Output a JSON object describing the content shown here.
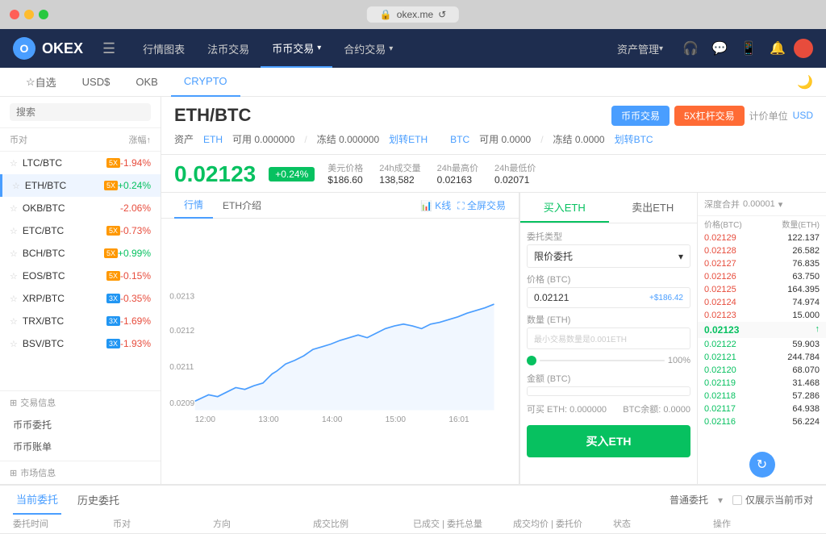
{
  "window": {
    "url": "okex.me",
    "lock_icon": "🔒"
  },
  "navbar": {
    "logo": "OKEX",
    "hamburger": "☰",
    "items": [
      {
        "label": "行情图表",
        "active": false
      },
      {
        "label": "法币交易",
        "active": false
      },
      {
        "label": "币币交易",
        "active": true,
        "dropdown": true
      },
      {
        "label": "合约交易",
        "active": false,
        "dropdown": true
      }
    ],
    "right_items": [
      {
        "label": "资产管理",
        "dropdown": true
      },
      {
        "label": "🎧"
      },
      {
        "label": "💬"
      },
      {
        "label": "📱"
      },
      {
        "label": "🔔"
      }
    ]
  },
  "subnav": {
    "items": [
      {
        "label": "☆ 自选",
        "active": false
      },
      {
        "label": "USD$",
        "active": false
      },
      {
        "label": "OKB",
        "active": false
      },
      {
        "label": "CRYPTO",
        "active": true
      }
    ]
  },
  "sidebar": {
    "search_placeholder": "搜索",
    "col1": "币对",
    "col2": "涨幅↑",
    "items": [
      {
        "pair": "LTC/BTC",
        "badge": "5X",
        "change": "-1.94%",
        "dir": "red"
      },
      {
        "pair": "ETH/BTC",
        "badge": "5X",
        "change": "+0.24%",
        "dir": "green",
        "active": true
      },
      {
        "pair": "OKB/BTC",
        "badge": null,
        "change": "-2.06%",
        "dir": "red"
      },
      {
        "pair": "ETC/BTC",
        "badge": "5X",
        "change": "-0.73%",
        "dir": "red"
      },
      {
        "pair": "BCH/BTC",
        "badge": "5X",
        "change": "+0.99%",
        "dir": "green"
      },
      {
        "pair": "EOS/BTC",
        "badge": "5X",
        "change": "-0.15%",
        "dir": "red"
      },
      {
        "pair": "XRP/BTC",
        "badge": "3X",
        "change": "-0.35%",
        "dir": "red"
      },
      {
        "pair": "TRX/BTC",
        "badge": "3X",
        "change": "-1.69%",
        "dir": "red"
      },
      {
        "pair": "BSV/BTC",
        "badge": "3X",
        "change": "-1.93%",
        "dir": "red"
      }
    ],
    "sections": [
      {
        "title": "交易信息",
        "links": [
          "币币委托",
          "币币账单"
        ]
      },
      {
        "title": "市场信息",
        "links": []
      }
    ]
  },
  "trading": {
    "pair": "ETH/BTC",
    "btn_trade": "币币交易",
    "btn_leverage": "5X杠杆交易",
    "unit_label": "计价单位",
    "unit_value": "USD",
    "asset": {
      "eth_label": "ETH",
      "eth_available": "可用 0.000000",
      "eth_frozen": "冻结 0.000000",
      "eth_transfer": "划转ETH",
      "btc_label": "BTC",
      "btc_available": "可用 0.0000",
      "btc_frozen": "冻结 0.0000",
      "btc_transfer": "划转BTC"
    },
    "price": "0.02123",
    "price_change": "+0.24%",
    "usd_label": "美元价格",
    "usd_value": "$186.60",
    "vol24h_label": "24h成交量",
    "vol24h_value": "138,582",
    "high24h_label": "24h最高价",
    "high24h_value": "0.02163",
    "low24h_label": "24h最低价",
    "low24h_value": "0.02071"
  },
  "chart_tabs": {
    "items": [
      {
        "label": "行情",
        "active": true
      },
      {
        "label": "ETH介绍",
        "active": false
      }
    ],
    "actions": [
      "📊 K线",
      "⛶ 全屏交易"
    ]
  },
  "order_form": {
    "tab_buy": "买入ETH",
    "tab_sell": "卖出ETH",
    "type_label": "委托类型",
    "type_value": "限价委托",
    "price_label": "价格 (BTC)",
    "price_value": "0.02121",
    "price_usd": "+$186.42",
    "amount_label": "数量 (ETH)",
    "amount_hint": "最小交易数量是0.001ETH",
    "pct_left": "0",
    "pct_right": "100%",
    "total_label": "金额 (BTC)",
    "available_eth": "可买 ETH: 0.000000",
    "available_btc": "BTC余额: 0.0000",
    "btn_buy": "买入ETH"
  },
  "orderbook": {
    "header_price": "价格(BTC)",
    "header_amount": "数量(ETH)",
    "merge_label": "深度合并",
    "merge_value": "0.00001",
    "asks": [
      {
        "price": "0.02129",
        "amount": "122.137"
      },
      {
        "price": "0.02128",
        "amount": "26.582"
      },
      {
        "price": "0.02127",
        "amount": "76.835"
      },
      {
        "price": "0.02126",
        "amount": "63.750"
      },
      {
        "price": "0.02125",
        "amount": "164.395"
      },
      {
        "price": "0.02124",
        "amount": "74.974"
      },
      {
        "price": "0.02123",
        "amount": "15.000"
      }
    ],
    "current_price": "0.02123",
    "current_arrow": "↑",
    "bids": [
      {
        "price": "0.02122",
        "amount": "59.903"
      },
      {
        "price": "0.02121",
        "amount": "244.784"
      },
      {
        "price": "0.02120",
        "amount": "68.070"
      },
      {
        "price": "0.02119",
        "amount": "31.468"
      },
      {
        "price": "0.02118",
        "amount": "57.286"
      },
      {
        "price": "0.02117",
        "amount": "64.938"
      },
      {
        "price": "0.02116",
        "amount": "56.224"
      }
    ]
  },
  "bottom": {
    "tabs": [
      {
        "label": "当前委托",
        "active": true
      },
      {
        "label": "历史委托",
        "active": false
      }
    ],
    "right_options": [
      "普通委托",
      "仅展示当前币对"
    ],
    "columns": [
      "委托时间",
      "币对",
      "方向",
      "成交比例",
      "已成交 | 委托总量",
      "成交均价 | 委托价",
      "状态",
      "操作"
    ]
  }
}
